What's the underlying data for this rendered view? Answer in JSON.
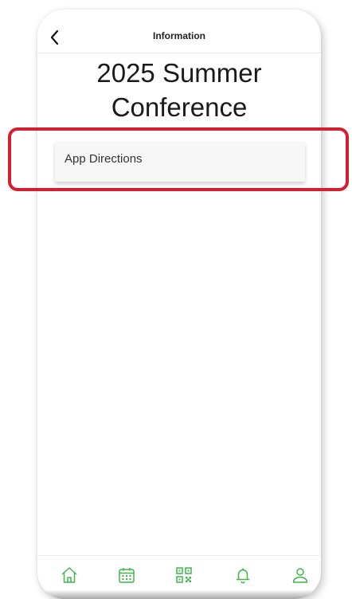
{
  "header": {
    "back_icon": "chevron-left-icon",
    "title": "Information"
  },
  "main": {
    "heading_line1": "2025 Summer",
    "heading_line2": "Conference",
    "items": [
      {
        "label": "App Directions"
      }
    ]
  },
  "tabbar": {
    "tabs": [
      {
        "icon": "home-icon"
      },
      {
        "icon": "calendar-icon"
      },
      {
        "icon": "qr-code-icon"
      },
      {
        "icon": "bell-icon"
      },
      {
        "icon": "user-icon"
      }
    ]
  },
  "colors": {
    "accent": "#3fb54a",
    "highlight": "#d1202f"
  }
}
